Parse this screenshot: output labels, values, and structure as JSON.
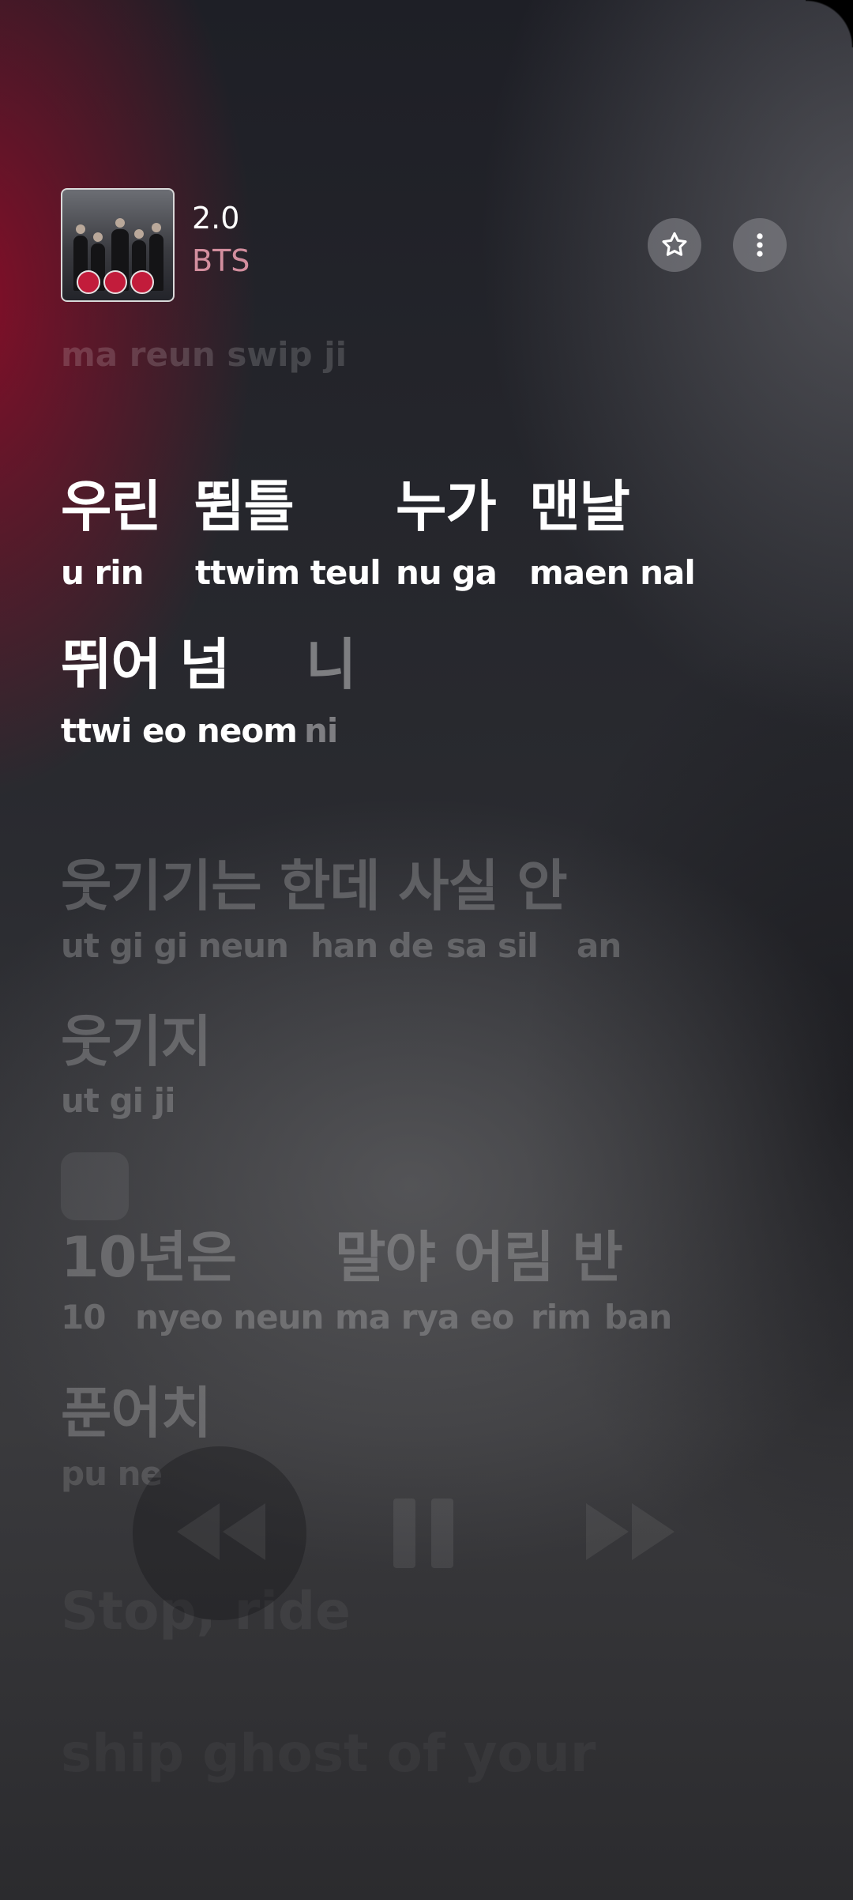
{
  "now_playing": {
    "title": "2.0",
    "artist": "BTS"
  },
  "icons": {
    "favorite": "star-icon",
    "more": "more-vertical-icon",
    "rewind": "rewind-icon",
    "pause": "pause-icon",
    "forward": "fast-forward-icon"
  },
  "colors": {
    "accent_red": "#b0102f",
    "artist_pink": "#d38e9e"
  },
  "lyrics": {
    "previous_romanization": "ma reun  swip ji",
    "lines": [
      {
        "korean": [
          "우린",
          "뜀틀",
          "누가",
          "맨날"
        ],
        "romanization": [
          "u rin",
          "ttwim teul",
          "nu ga",
          "maen nal"
        ]
      },
      {
        "korean": [
          "뛰어 넘",
          "니"
        ],
        "romanization": [
          "ttwi eo neom",
          "ni"
        ]
      },
      {
        "korean": [
          "웃기기는 한데 사실 안"
        ],
        "romanization": [
          "ut gi gi neun",
          "han de",
          "sa sil",
          "an"
        ]
      },
      {
        "korean": [
          "웃기지"
        ],
        "romanization": [
          "ut gi ji"
        ]
      },
      {
        "korean": [
          "10년은",
          "말야 어림 반"
        ],
        "romanization": [
          "10",
          "nyeo neun",
          "ma rya",
          "eo",
          "rim",
          "ban"
        ]
      },
      {
        "korean": [
          "푼어치"
        ],
        "romanization": [
          "pu ne"
        ]
      }
    ],
    "ghost_lines": [
      "Stop, ride",
      "ship ghost of your"
    ]
  }
}
